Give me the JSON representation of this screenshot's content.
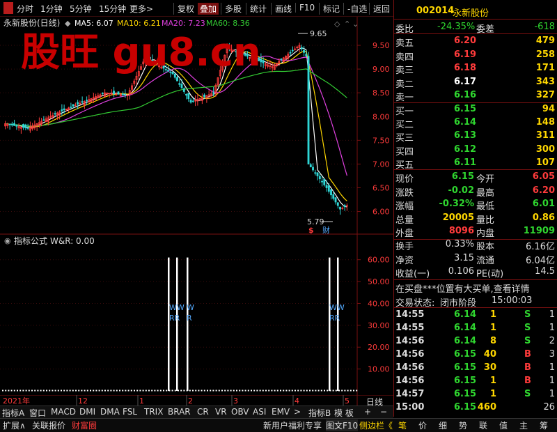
{
  "toolbar": {
    "items": [
      "分时",
      "1分钟",
      "5分钟",
      "15分钟",
      "更多>",
      "复权",
      "叠加",
      "多股",
      "统计",
      "画线",
      "F10",
      "标记",
      "-自选",
      "返回"
    ]
  },
  "stock": {
    "code": "002014",
    "name": "永新股份"
  },
  "kchart": {
    "title": "永新股份(日线)",
    "ma": [
      {
        "label": "MA5: 6.07",
        "color": "#ffffff"
      },
      {
        "label": "MA10: 6.21",
        "color": "#ffd700"
      },
      {
        "label": "MA20: 7.23",
        "color": "#e040e0"
      },
      {
        "label": "MA60: 8.36",
        "color": "#33cc33"
      }
    ],
    "watermark": "股旺 gu8.cn",
    "high_label": "9.65",
    "low_label": "5.79",
    "markers": [
      "$",
      "财"
    ],
    "y_ticks": [
      "9.50",
      "9.00",
      "8.50",
      "8.00",
      "7.50",
      "7.00",
      "6.50",
      "6.00"
    ],
    "x_labels": [
      "2021年",
      "12",
      "1",
      "2",
      "3",
      "4",
      "5"
    ]
  },
  "indicator": {
    "title": "指标公式",
    "value_label": "W&R: 0.00",
    "y_ticks": [
      "60.00",
      "50.00",
      "40.00",
      "30.00",
      "20.00",
      "10.00"
    ],
    "signal_top": "WW",
    "signal_bottom": "RR",
    "signal_single_top": "W",
    "signal_single_bottom": "R"
  },
  "panel": {
    "weibi": {
      "label": "委比",
      "value": "-24.35%",
      "label2": "委差",
      "value2": "-618"
    },
    "sell": [
      {
        "label": "卖五",
        "price": "6.20",
        "vol": "479"
      },
      {
        "label": "卖四",
        "price": "6.19",
        "vol": "258"
      },
      {
        "label": "卖三",
        "price": "6.18",
        "vol": "171"
      },
      {
        "label": "卖二",
        "price": "6.17",
        "vol": "343"
      },
      {
        "label": "卖一",
        "price": "6.16",
        "vol": "327"
      }
    ],
    "buy": [
      {
        "label": "买一",
        "price": "6.15",
        "vol": "94"
      },
      {
        "label": "买二",
        "price": "6.14",
        "vol": "148"
      },
      {
        "label": "买三",
        "price": "6.13",
        "vol": "311"
      },
      {
        "label": "买四",
        "price": "6.12",
        "vol": "300"
      },
      {
        "label": "买五",
        "price": "6.11",
        "vol": "107"
      }
    ],
    "quote": [
      {
        "l1": "现价",
        "v1": "6.15",
        "l2": "今开",
        "v2": "6.05"
      },
      {
        "l1": "涨跌",
        "v1": "-0.02",
        "l2": "最高",
        "v2": "6.20"
      },
      {
        "l1": "涨幅",
        "v1": "-0.32%",
        "l2": "最低",
        "v2": "6.01"
      },
      {
        "l1": "总量",
        "v1": "20005",
        "l2": "量比",
        "v2": "0.86"
      },
      {
        "l1": "外盘",
        "v1": "8096",
        "l2": "内盘",
        "v2": "11909"
      }
    ],
    "fundamentals": [
      {
        "l1": "换手",
        "v1": "0.33%",
        "l2": "股本",
        "v2": "6.16亿"
      },
      {
        "l1": "净资",
        "v1": "3.15",
        "l2": "流通",
        "v2": "6.04亿"
      },
      {
        "l1": "收益(一)",
        "v1": "0.106",
        "l2": "PE(动)",
        "v2": "14.5"
      }
    ],
    "notice": "在买盘***位置有大买单,查看详情",
    "trade_status": {
      "label": "交易状态:",
      "value": "闭市阶段",
      "time": "15:00:03"
    },
    "ticks": [
      {
        "time": "14:55",
        "price": "6.14",
        "vol": "1",
        "side": "S",
        "n": "1"
      },
      {
        "time": "14:55",
        "price": "6.14",
        "vol": "1",
        "side": "S",
        "n": "1"
      },
      {
        "time": "14:56",
        "price": "6.14",
        "vol": "8",
        "side": "S",
        "n": "2"
      },
      {
        "time": "14:56",
        "price": "6.15",
        "vol": "40",
        "side": "B",
        "n": "3"
      },
      {
        "time": "14:56",
        "price": "6.15",
        "vol": "30",
        "side": "B",
        "n": "1"
      },
      {
        "time": "14:56",
        "price": "6.15",
        "vol": "1",
        "side": "B",
        "n": "1"
      },
      {
        "time": "14:57",
        "price": "6.15",
        "vol": "1",
        "side": "S",
        "n": "1"
      },
      {
        "time": "15:00",
        "price": "6.15",
        "vol": "460",
        "side": "",
        "n": "26"
      }
    ]
  },
  "bottom_tabs": {
    "row1": [
      "指标A",
      "窗口",
      "MACD",
      "DMI",
      "DMA",
      "FSL",
      "TRIX",
      "BRAR",
      "CR",
      "VR",
      "OBV",
      "ASI",
      "EMV",
      ">",
      "指标B",
      "模 板",
      "+",
      "−"
    ],
    "period": "日线",
    "row2": [
      "扩展∧",
      "关联报价",
      "财富圈",
      "新用户福利专享",
      "图文F10",
      "侧边栏《"
    ],
    "side_tabs": [
      "笔",
      "价",
      "细",
      "势",
      "联",
      "值",
      "主",
      "筹"
    ]
  },
  "colors": {
    "up": "#ff3b3b",
    "down": "#2fd62f",
    "accent": "#7a1010"
  }
}
